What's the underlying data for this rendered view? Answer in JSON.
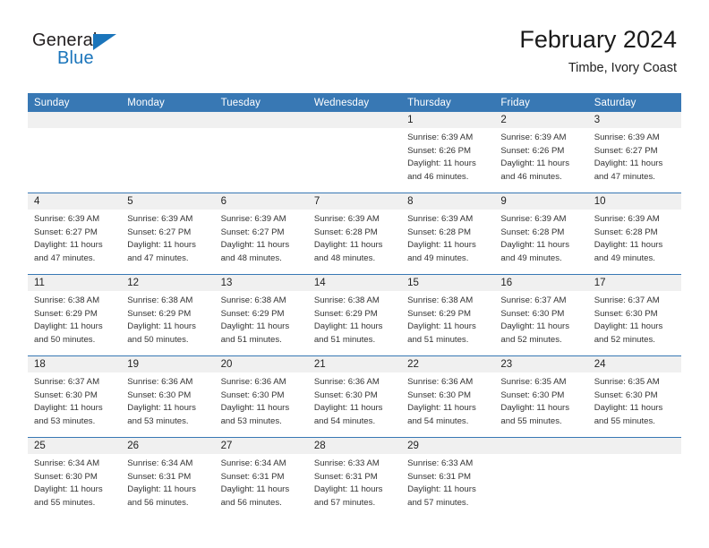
{
  "brand": {
    "name_top": "General",
    "name_bottom": "Blue",
    "accent_color": "#1b75bb",
    "logo_icon": "triangle-icon"
  },
  "header": {
    "title": "February 2024",
    "subtitle": "Timbe, Ivory Coast"
  },
  "theme": {
    "header_row_bg": "#3878b4",
    "header_row_text": "#ffffff",
    "daynum_band_bg": "#f0f0f0",
    "row_divider": "#3878b4",
    "body_text": "#333333"
  },
  "calendar": {
    "weekday_headers": [
      "Sunday",
      "Monday",
      "Tuesday",
      "Wednesday",
      "Thursday",
      "Friday",
      "Saturday"
    ],
    "labels": {
      "sunrise": "Sunrise:",
      "sunset": "Sunset:",
      "daylight": "Daylight:"
    },
    "weeks": [
      [
        {
          "day": "",
          "lines": []
        },
        {
          "day": "",
          "lines": []
        },
        {
          "day": "",
          "lines": []
        },
        {
          "day": "",
          "lines": []
        },
        {
          "day": "1",
          "lines": [
            "Sunrise: 6:39 AM",
            "Sunset: 6:26 PM",
            "Daylight: 11 hours",
            "and 46 minutes."
          ]
        },
        {
          "day": "2",
          "lines": [
            "Sunrise: 6:39 AM",
            "Sunset: 6:26 PM",
            "Daylight: 11 hours",
            "and 46 minutes."
          ]
        },
        {
          "day": "3",
          "lines": [
            "Sunrise: 6:39 AM",
            "Sunset: 6:27 PM",
            "Daylight: 11 hours",
            "and 47 minutes."
          ]
        }
      ],
      [
        {
          "day": "4",
          "lines": [
            "Sunrise: 6:39 AM",
            "Sunset: 6:27 PM",
            "Daylight: 11 hours",
            "and 47 minutes."
          ]
        },
        {
          "day": "5",
          "lines": [
            "Sunrise: 6:39 AM",
            "Sunset: 6:27 PM",
            "Daylight: 11 hours",
            "and 47 minutes."
          ]
        },
        {
          "day": "6",
          "lines": [
            "Sunrise: 6:39 AM",
            "Sunset: 6:27 PM",
            "Daylight: 11 hours",
            "and 48 minutes."
          ]
        },
        {
          "day": "7",
          "lines": [
            "Sunrise: 6:39 AM",
            "Sunset: 6:28 PM",
            "Daylight: 11 hours",
            "and 48 minutes."
          ]
        },
        {
          "day": "8",
          "lines": [
            "Sunrise: 6:39 AM",
            "Sunset: 6:28 PM",
            "Daylight: 11 hours",
            "and 49 minutes."
          ]
        },
        {
          "day": "9",
          "lines": [
            "Sunrise: 6:39 AM",
            "Sunset: 6:28 PM",
            "Daylight: 11 hours",
            "and 49 minutes."
          ]
        },
        {
          "day": "10",
          "lines": [
            "Sunrise: 6:39 AM",
            "Sunset: 6:28 PM",
            "Daylight: 11 hours",
            "and 49 minutes."
          ]
        }
      ],
      [
        {
          "day": "11",
          "lines": [
            "Sunrise: 6:38 AM",
            "Sunset: 6:29 PM",
            "Daylight: 11 hours",
            "and 50 minutes."
          ]
        },
        {
          "day": "12",
          "lines": [
            "Sunrise: 6:38 AM",
            "Sunset: 6:29 PM",
            "Daylight: 11 hours",
            "and 50 minutes."
          ]
        },
        {
          "day": "13",
          "lines": [
            "Sunrise: 6:38 AM",
            "Sunset: 6:29 PM",
            "Daylight: 11 hours",
            "and 51 minutes."
          ]
        },
        {
          "day": "14",
          "lines": [
            "Sunrise: 6:38 AM",
            "Sunset: 6:29 PM",
            "Daylight: 11 hours",
            "and 51 minutes."
          ]
        },
        {
          "day": "15",
          "lines": [
            "Sunrise: 6:38 AM",
            "Sunset: 6:29 PM",
            "Daylight: 11 hours",
            "and 51 minutes."
          ]
        },
        {
          "day": "16",
          "lines": [
            "Sunrise: 6:37 AM",
            "Sunset: 6:30 PM",
            "Daylight: 11 hours",
            "and 52 minutes."
          ]
        },
        {
          "day": "17",
          "lines": [
            "Sunrise: 6:37 AM",
            "Sunset: 6:30 PM",
            "Daylight: 11 hours",
            "and 52 minutes."
          ]
        }
      ],
      [
        {
          "day": "18",
          "lines": [
            "Sunrise: 6:37 AM",
            "Sunset: 6:30 PM",
            "Daylight: 11 hours",
            "and 53 minutes."
          ]
        },
        {
          "day": "19",
          "lines": [
            "Sunrise: 6:36 AM",
            "Sunset: 6:30 PM",
            "Daylight: 11 hours",
            "and 53 minutes."
          ]
        },
        {
          "day": "20",
          "lines": [
            "Sunrise: 6:36 AM",
            "Sunset: 6:30 PM",
            "Daylight: 11 hours",
            "and 53 minutes."
          ]
        },
        {
          "day": "21",
          "lines": [
            "Sunrise: 6:36 AM",
            "Sunset: 6:30 PM",
            "Daylight: 11 hours",
            "and 54 minutes."
          ]
        },
        {
          "day": "22",
          "lines": [
            "Sunrise: 6:36 AM",
            "Sunset: 6:30 PM",
            "Daylight: 11 hours",
            "and 54 minutes."
          ]
        },
        {
          "day": "23",
          "lines": [
            "Sunrise: 6:35 AM",
            "Sunset: 6:30 PM",
            "Daylight: 11 hours",
            "and 55 minutes."
          ]
        },
        {
          "day": "24",
          "lines": [
            "Sunrise: 6:35 AM",
            "Sunset: 6:30 PM",
            "Daylight: 11 hours",
            "and 55 minutes."
          ]
        }
      ],
      [
        {
          "day": "25",
          "lines": [
            "Sunrise: 6:34 AM",
            "Sunset: 6:30 PM",
            "Daylight: 11 hours",
            "and 55 minutes."
          ]
        },
        {
          "day": "26",
          "lines": [
            "Sunrise: 6:34 AM",
            "Sunset: 6:31 PM",
            "Daylight: 11 hours",
            "and 56 minutes."
          ]
        },
        {
          "day": "27",
          "lines": [
            "Sunrise: 6:34 AM",
            "Sunset: 6:31 PM",
            "Daylight: 11 hours",
            "and 56 minutes."
          ]
        },
        {
          "day": "28",
          "lines": [
            "Sunrise: 6:33 AM",
            "Sunset: 6:31 PM",
            "Daylight: 11 hours",
            "and 57 minutes."
          ]
        },
        {
          "day": "29",
          "lines": [
            "Sunrise: 6:33 AM",
            "Sunset: 6:31 PM",
            "Daylight: 11 hours",
            "and 57 minutes."
          ]
        },
        {
          "day": "",
          "lines": []
        },
        {
          "day": "",
          "lines": []
        }
      ]
    ]
  }
}
